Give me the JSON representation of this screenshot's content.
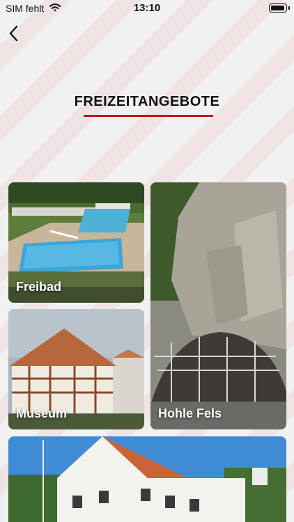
{
  "status_bar": {
    "carrier": "SIM fehlt",
    "time": "13:10",
    "icons": [
      "wifi-icon",
      "battery-icon"
    ]
  },
  "nav": {
    "back_icon": "chevron-left-icon"
  },
  "page": {
    "title": "FREIZEITANGEBOTE",
    "accent_color": "#c0171d"
  },
  "tiles": [
    {
      "label": "Freibad"
    },
    {
      "label": "Museum"
    },
    {
      "label": "Hohle Fels"
    },
    {
      "label": ""
    }
  ]
}
